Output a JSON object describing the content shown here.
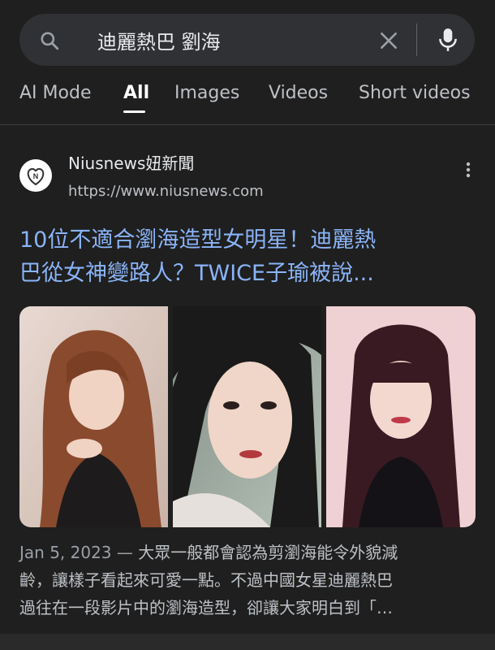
{
  "search": {
    "query": "迪麗熱巴 劉海",
    "icon_search": "search-icon",
    "icon_clear": "close-icon",
    "icon_voice": "microphone-icon"
  },
  "tabs": [
    {
      "label": "AI Mode",
      "active": false
    },
    {
      "label": "All",
      "active": true
    },
    {
      "label": "Images",
      "active": false
    },
    {
      "label": "Videos",
      "active": false
    },
    {
      "label": "Short videos",
      "active": false
    }
  ],
  "result": {
    "site_name": "Niusnews妞新聞",
    "site_url": "https://www.niusnews.com",
    "logo_letter": "N",
    "title_lines": [
      "10位不適合瀏海造型女明星！迪麗熱",
      "巴從女神變路人？TWICE子瑜被說..."
    ],
    "images": [
      {
        "alt": "woman-with-long-wavy-auburn-hair"
      },
      {
        "alt": "woman-close-up-portrait"
      },
      {
        "alt": "woman-with-bangs-dark-hair"
      }
    ],
    "snippet_date": "Jan 5, 2023",
    "snippet_sep": " — ",
    "snippet_line1": "大眾一般都會認為剪瀏海能令外貌減",
    "snippet_line2": "齡，讓樣子看起來可愛一點。不過中國女星迪麗熱巴",
    "snippet_line3": "過往在一段影片中的瀏海造型，卻讓大家明白到「…"
  },
  "colors": {
    "background": "#1f1f1f",
    "link": "#8ab4f8",
    "search_bar": "#303134"
  }
}
